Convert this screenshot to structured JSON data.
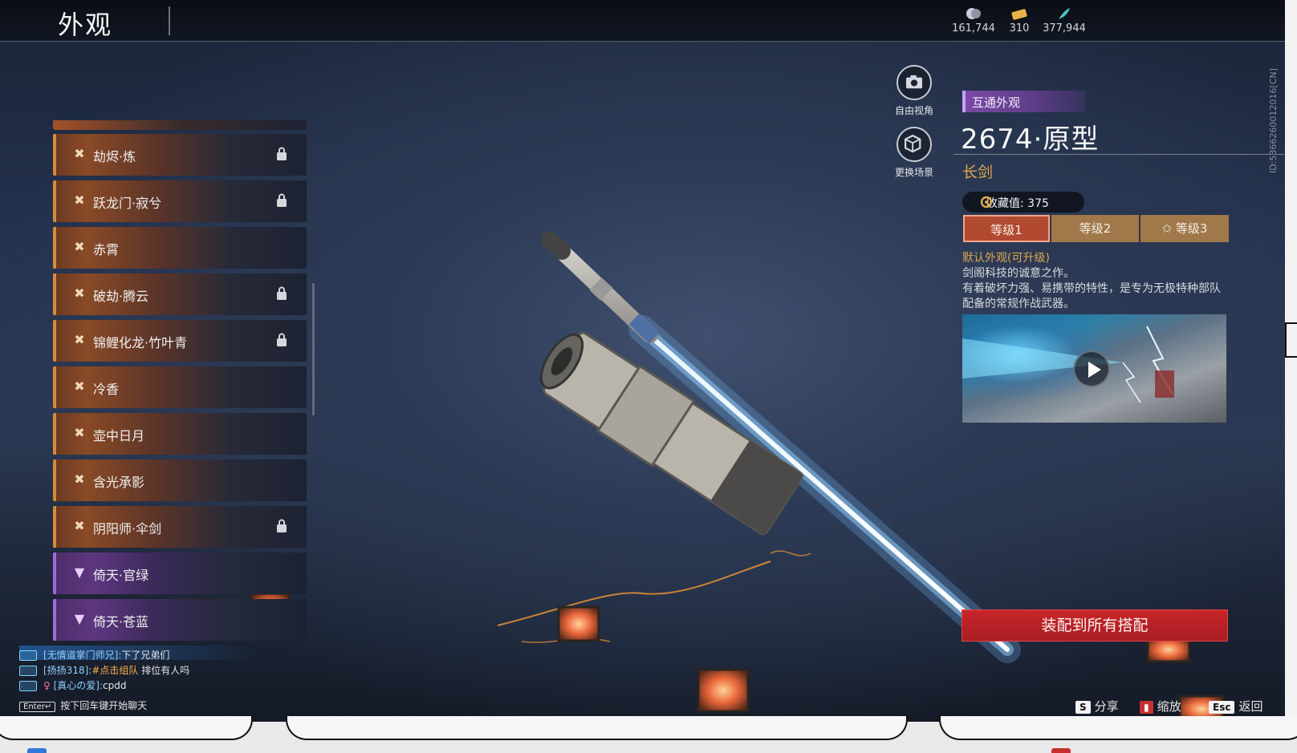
{
  "header": {
    "title": "外观"
  },
  "currency": [
    {
      "icon": "coin-icon",
      "value": "161,744"
    },
    {
      "icon": "ticket-icon",
      "value": "310"
    },
    {
      "icon": "feather-icon",
      "value": "377,944"
    }
  ],
  "user_id": "ID:5366260012016[CN]",
  "list": {
    "items": [
      {
        "label": "劫烬·炼",
        "rarity": "gold",
        "locked": true
      },
      {
        "label": "跃龙门·寂兮",
        "rarity": "gold",
        "locked": true
      },
      {
        "label": "赤霄",
        "rarity": "gold",
        "locked": false
      },
      {
        "label": "破劫·腾云",
        "rarity": "gold",
        "locked": true
      },
      {
        "label": "锦鲤化龙·竹叶青",
        "rarity": "gold",
        "locked": true
      },
      {
        "label": "冷香",
        "rarity": "gold",
        "locked": false
      },
      {
        "label": "壶中日月",
        "rarity": "gold",
        "locked": false
      },
      {
        "label": "含光承影",
        "rarity": "gold",
        "locked": false
      },
      {
        "label": "阴阳师·伞剑",
        "rarity": "gold",
        "locked": true
      },
      {
        "label": "倚天·官绿",
        "rarity": "purple",
        "locked": false
      },
      {
        "label": "倚天·苍蓝",
        "rarity": "purple",
        "locked": false
      }
    ]
  },
  "camera": {
    "free_view": "自由视角",
    "change_scene": "更换场景"
  },
  "detail": {
    "tag": "互通外观",
    "name": "2674·原型",
    "type": "长剑",
    "collect_label": "收藏值: 375",
    "tabs": [
      "等级1",
      "等级2",
      "等级3"
    ],
    "desc_title": "默认外观(可升级)",
    "desc_lines": [
      "剑阁科技的诚意之作。",
      "有着破坏力强、易携带的特性，是专为无极特种部队配备的常规作战武器。"
    ],
    "equip_button": "装配到所有搭配"
  },
  "chat": [
    {
      "who": "[无情道掌门师兄]:",
      "msg": "下了兄弟们"
    },
    {
      "who": "[扬扬318]:",
      "hint": "#点击组队",
      "msg": " 排位有人吗"
    },
    {
      "who": "[真心の爱]:",
      "msg": "cpdd"
    }
  ],
  "chat_tip": {
    "key": "Enter↵",
    "text": "按下回车键开始聊天"
  },
  "hints": {
    "share_key": "S",
    "share": "分享",
    "zoom": "缩放",
    "back_key": "Esc",
    "back": "返回"
  },
  "colors": {
    "accent_gold": "#e0a84f",
    "tag_purple": "#7b4aa6",
    "equip_red": "#c8262a",
    "tab_active": "#b24a32"
  }
}
